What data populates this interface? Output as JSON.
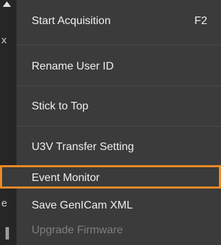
{
  "left_fragments": {
    "f1": "x",
    "f2": "e"
  },
  "menu": {
    "items": [
      {
        "label": "Start Acquisition",
        "shortcut": "F2"
      },
      {
        "label": "Rename User ID"
      },
      {
        "label": "Stick to Top"
      },
      {
        "label": "U3V Transfer Setting"
      },
      {
        "label": "Event Monitor",
        "selected": true
      },
      {
        "label": "Save GenICam XML"
      },
      {
        "label": "Upgrade Firmware",
        "disabled": true
      }
    ]
  },
  "colors": {
    "menu_bg": "#3b3b3b",
    "highlight": "#f08a24",
    "text": "#f0f0f0",
    "disabled_text": "#7f7f7f"
  }
}
